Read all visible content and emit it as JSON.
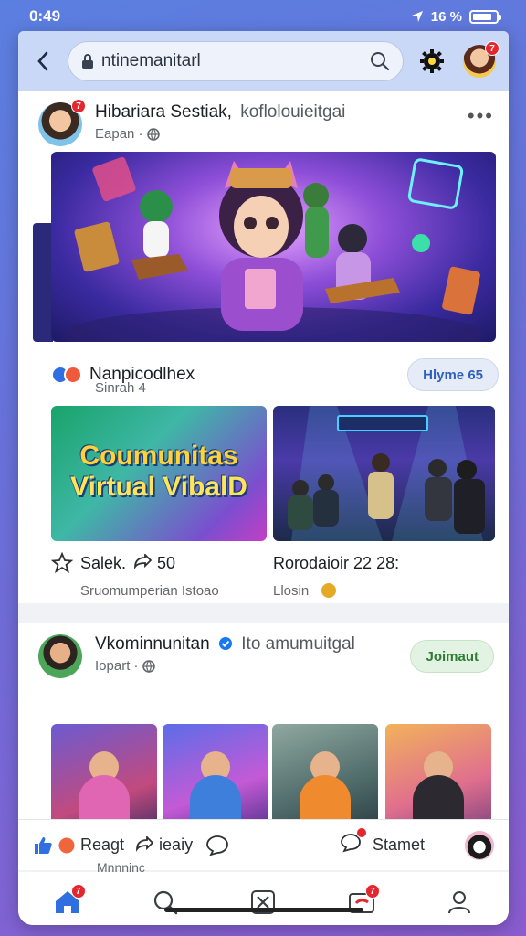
{
  "status": {
    "time": "0:49",
    "battery_text": "16 %"
  },
  "top_bar": {
    "search_text": "ntinemanitarl"
  },
  "post1": {
    "author": "Hibariara Sestiak,",
    "author_sub": "koflolouieitgai",
    "time": "Eapan ·"
  },
  "group": {
    "name": "Nanpicodlhex",
    "sub": "Sinrah 4",
    "button": "Hlyme 65"
  },
  "thumb_a": {
    "line1": "Coumunitas",
    "line2": "Virtual VibalD"
  },
  "captions": {
    "left_title": "Salek.",
    "left_count": "50",
    "left_sub": "Sruomumperian Istoao",
    "right_title": "Rorodaioir 22 28:",
    "right_sub": "Llosin"
  },
  "post2": {
    "author": "Vkominnunitan",
    "author_sub": "Ito amumuitgal",
    "time": "Iopart ·",
    "button": "Joimaut"
  },
  "actions": {
    "react": "Reagt",
    "react_sub": "Mnnninc",
    "share": "ieaiy",
    "comment": "Stamet"
  },
  "badges": {
    "avatar": "7",
    "post_avatar": "7",
    "nav_home": "7",
    "nav_video": "7"
  }
}
